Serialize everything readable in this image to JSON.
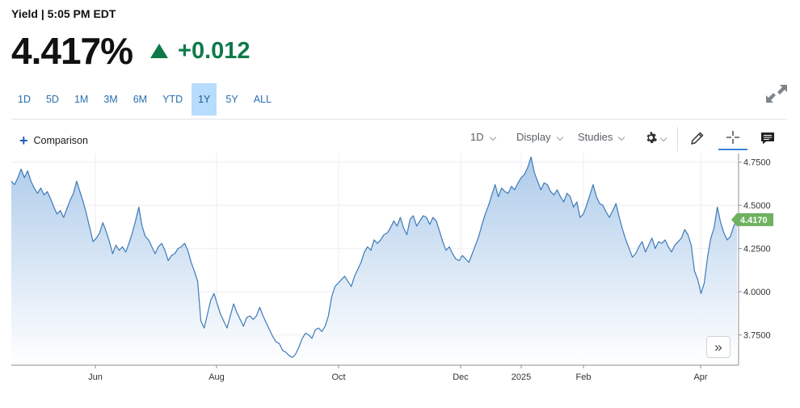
{
  "header": {
    "label": "Yield",
    "separator": "|",
    "time": "5:05 PM EDT",
    "price": "4.417%",
    "change": "+0.012",
    "up_color": "#0e7a49"
  },
  "range_tabs": [
    "1D",
    "5D",
    "1M",
    "3M",
    "6M",
    "YTD",
    "1Y",
    "5Y",
    "ALL"
  ],
  "active_range": "1Y",
  "toolbar": {
    "comparison_plus": "+",
    "comparison_label": "Comparison",
    "interval_label": "1D",
    "display_label": "Display",
    "studies_label": "Studies",
    "icons": [
      "expand-icon",
      "settings-icon",
      "draw-pencil-icon",
      "crosshair-icon",
      "comment-icon"
    ]
  },
  "scroll_button": "»",
  "chart_data": {
    "type": "area",
    "series": [
      {
        "values": [
          4.64,
          4.62,
          4.66,
          4.71,
          4.66,
          4.7,
          4.64,
          4.6,
          4.57,
          4.6,
          4.56,
          4.58,
          4.54,
          4.49,
          4.45,
          4.47,
          4.43,
          4.48,
          4.53,
          4.57,
          4.64,
          4.58,
          4.52,
          4.45,
          4.37,
          4.29,
          4.31,
          4.34,
          4.4,
          4.35,
          4.29,
          4.22,
          4.27,
          4.24,
          4.26,
          4.23,
          4.28,
          4.34,
          4.41,
          4.49,
          4.38,
          4.32,
          4.3,
          4.26,
          4.22,
          4.26,
          4.28,
          4.24,
          4.18,
          4.21,
          4.22,
          4.25,
          4.26,
          4.28,
          4.24,
          4.17,
          4.12,
          4.06,
          3.83,
          3.79,
          3.87,
          3.95,
          3.99,
          3.93,
          3.87,
          3.83,
          3.79,
          3.86,
          3.93,
          3.88,
          3.84,
          3.8,
          3.85,
          3.86,
          3.84,
          3.86,
          3.91,
          3.86,
          3.82,
          3.78,
          3.74,
          3.71,
          3.7,
          3.66,
          3.65,
          3.63,
          3.62,
          3.64,
          3.68,
          3.73,
          3.76,
          3.75,
          3.73,
          3.78,
          3.79,
          3.77,
          3.8,
          3.86,
          3.97,
          4.03,
          4.05,
          4.07,
          4.09,
          4.06,
          4.03,
          4.09,
          4.13,
          4.17,
          4.23,
          4.26,
          4.24,
          4.3,
          4.28,
          4.3,
          4.33,
          4.34,
          4.37,
          4.41,
          4.38,
          4.43,
          4.37,
          4.33,
          4.42,
          4.44,
          4.38,
          4.41,
          4.44,
          4.43,
          4.39,
          4.43,
          4.41,
          4.35,
          4.29,
          4.24,
          4.26,
          4.22,
          4.19,
          4.18,
          4.21,
          4.19,
          4.17,
          4.22,
          4.27,
          4.32,
          4.39,
          4.45,
          4.5,
          4.56,
          4.62,
          4.55,
          4.6,
          4.58,
          4.57,
          4.61,
          4.59,
          4.63,
          4.66,
          4.68,
          4.72,
          4.78,
          4.69,
          4.64,
          4.59,
          4.63,
          4.62,
          4.58,
          4.56,
          4.59,
          4.55,
          4.52,
          4.57,
          4.55,
          4.49,
          4.52,
          4.43,
          4.45,
          4.5,
          4.56,
          4.62,
          4.55,
          4.51,
          4.5,
          4.46,
          4.43,
          4.47,
          4.51,
          4.43,
          4.36,
          4.3,
          4.25,
          4.2,
          4.22,
          4.26,
          4.29,
          4.23,
          4.27,
          4.31,
          4.25,
          4.29,
          4.28,
          4.3,
          4.26,
          4.23,
          4.27,
          4.29,
          4.31,
          4.36,
          4.33,
          4.27,
          4.12,
          4.07,
          3.99,
          4.05,
          4.2,
          4.31,
          4.37,
          4.49,
          4.4,
          4.34,
          4.3,
          4.32,
          4.38,
          4.417
        ]
      }
    ],
    "x_tick_labels": [
      "Jun",
      "Aug",
      "Oct",
      "Dec",
      "2025",
      "Feb",
      "Apr"
    ],
    "y_tick_labels": [
      "3.7500",
      "4.0000",
      "4.2500",
      "4.5000",
      "4.7500"
    ],
    "y_ticks": [
      3.75,
      4.0,
      4.25,
      4.5,
      4.75
    ],
    "ylim": [
      3.575,
      4.8
    ],
    "last_value_label": "4.4170",
    "last_value": 4.417,
    "line_color": "#3d7ab8",
    "fill_color_top": "#a9c8e9",
    "fill_color_bottom": "#ffffff",
    "tag_color": "#6eb15f",
    "grid": true,
    "y_axis_position": "right"
  }
}
